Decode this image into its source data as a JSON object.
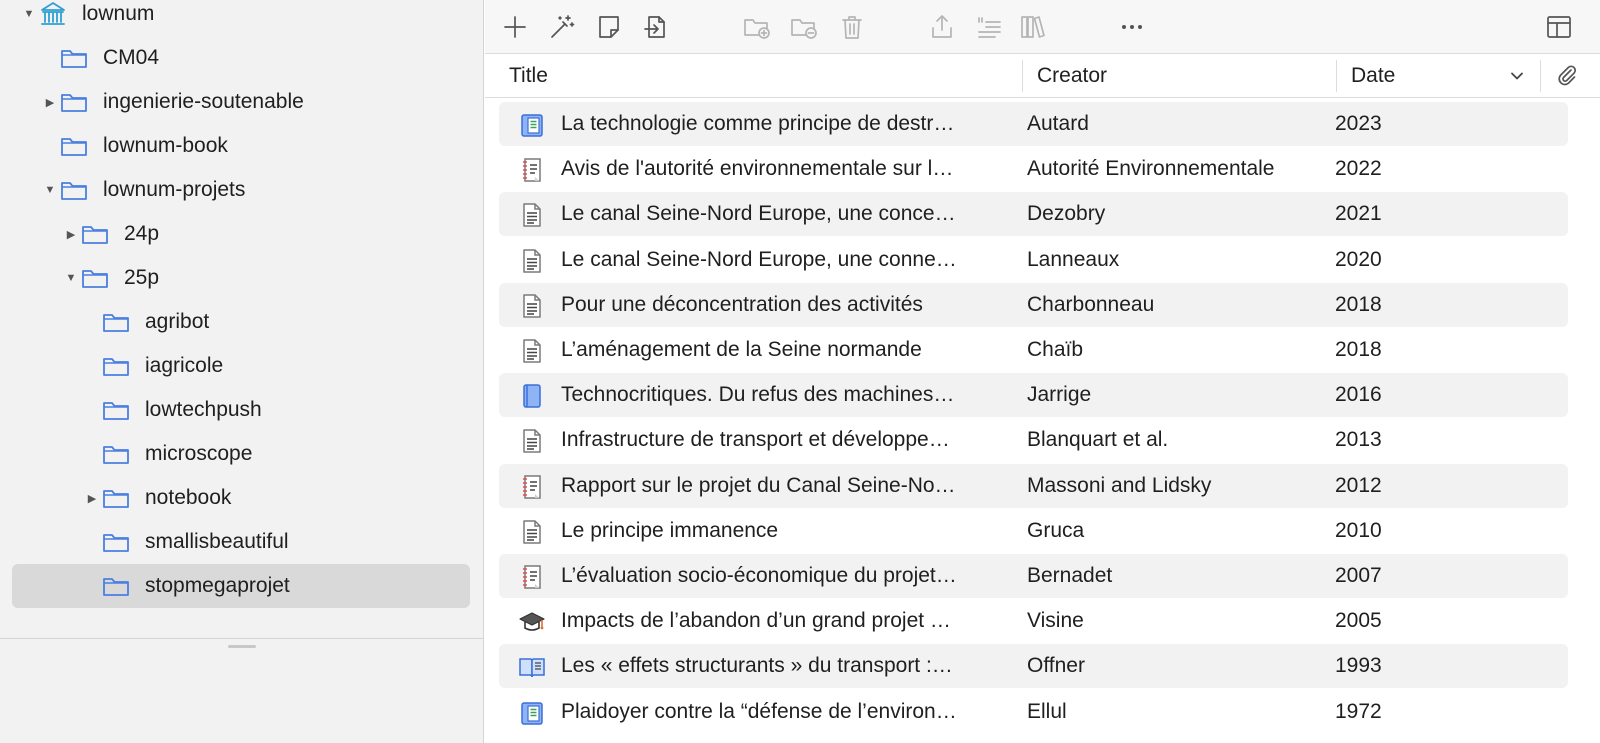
{
  "colors": {
    "folder_blue": "#4a7fe0",
    "library_teal": "#2f9fd1",
    "selection_gray": "#d9d9d9",
    "toolbar_icon": "#555555",
    "toolbar_icon_disabled": "#b5b5b5"
  },
  "collections": {
    "items": [
      {
        "label": "lownum",
        "icon": "library-icon",
        "expanded": true
      },
      {
        "label": "CM04",
        "icon": "folder-icon"
      },
      {
        "label": "ingenierie-soutenable",
        "icon": "folder-icon",
        "expanded": false
      },
      {
        "label": "lownum-book",
        "icon": "folder-icon"
      },
      {
        "label": "lownum-projets",
        "icon": "folder-icon",
        "expanded": true
      },
      {
        "label": "24p",
        "icon": "folder-icon",
        "expanded": false
      },
      {
        "label": "25p",
        "icon": "folder-icon",
        "expanded": true
      },
      {
        "label": "agribot",
        "icon": "folder-icon"
      },
      {
        "label": "iagricole",
        "icon": "folder-icon"
      },
      {
        "label": "lowtechpush",
        "icon": "folder-icon"
      },
      {
        "label": "microscope",
        "icon": "folder-icon"
      },
      {
        "label": "notebook",
        "icon": "folder-icon",
        "expanded": false
      },
      {
        "label": "smallisbeautiful",
        "icon": "folder-icon"
      },
      {
        "label": "stopmegaprojet",
        "icon": "folder-icon",
        "selected": true
      }
    ]
  },
  "toolbar": {
    "buttons": [
      {
        "icon": "plus-icon",
        "enabled": true
      },
      {
        "icon": "magic-wand-icon",
        "enabled": true
      },
      {
        "icon": "note-icon",
        "enabled": true
      },
      {
        "icon": "import-file-icon",
        "enabled": true
      },
      {
        "icon": "new-subcollection-icon",
        "enabled": false
      },
      {
        "icon": "remove-collection-icon",
        "enabled": false
      },
      {
        "icon": "trash-icon",
        "enabled": false
      },
      {
        "icon": "export-icon",
        "enabled": false
      },
      {
        "icon": "cite-icon",
        "enabled": false
      },
      {
        "icon": "library-books-icon",
        "enabled": false
      },
      {
        "icon": "more-icon",
        "enabled": true
      },
      {
        "icon": "layout-icon",
        "enabled": true
      }
    ]
  },
  "columns": {
    "title": "Title",
    "creator": "Creator",
    "date": "Date",
    "sort_icon": "chevron-down-icon",
    "attachment_icon": "paperclip-icon"
  },
  "items": [
    {
      "icon": "book-section-icon",
      "title": "La technologie comme principe de destr…",
      "creator": "Autard",
      "date": "2023"
    },
    {
      "icon": "report-icon",
      "title": "Avis de l'autorité environnementale sur l…",
      "creator": "Autorité Environnementale",
      "date": "2022"
    },
    {
      "icon": "document-icon",
      "title": "Le canal Seine-Nord Europe, une conce…",
      "creator": "Dezobry",
      "date": "2021"
    },
    {
      "icon": "document-icon",
      "title": "Le canal Seine-Nord Europe, une conne…",
      "creator": "Lanneaux",
      "date": "2020"
    },
    {
      "icon": "document-icon",
      "title": "Pour une déconcentration des activités",
      "creator": "Charbonneau",
      "date": "2018"
    },
    {
      "icon": "document-icon",
      "title": "L’aménagement de la Seine normande",
      "creator": "Chaïb",
      "date": "2018"
    },
    {
      "icon": "book-icon",
      "title": "Technocritiques. Du refus des machines…",
      "creator": "Jarrige",
      "date": "2016"
    },
    {
      "icon": "document-icon",
      "title": "Infrastructure de transport et développe…",
      "creator": "Blanquart et al.",
      "date": "2013"
    },
    {
      "icon": "report-icon",
      "title": "Rapport sur le projet du Canal Seine-No…",
      "creator": "Massoni and Lidsky",
      "date": "2012"
    },
    {
      "icon": "document-icon",
      "title": "Le principe immanence",
      "creator": "Gruca",
      "date": "2010"
    },
    {
      "icon": "report-icon",
      "title": "L’évaluation socio-économique du projet…",
      "creator": "Bernadet",
      "date": "2007"
    },
    {
      "icon": "thesis-icon",
      "title": "Impacts de l’abandon d’un grand projet …",
      "creator": "Visine",
      "date": "2005"
    },
    {
      "icon": "journal-article-icon",
      "title": "Les « effets structurants » du transport :…",
      "creator": "Offner",
      "date": "1993"
    },
    {
      "icon": "book-section-icon",
      "title": "Plaidoyer contre la “défense de l’environ…",
      "creator": "Ellul",
      "date": "1972"
    }
  ]
}
